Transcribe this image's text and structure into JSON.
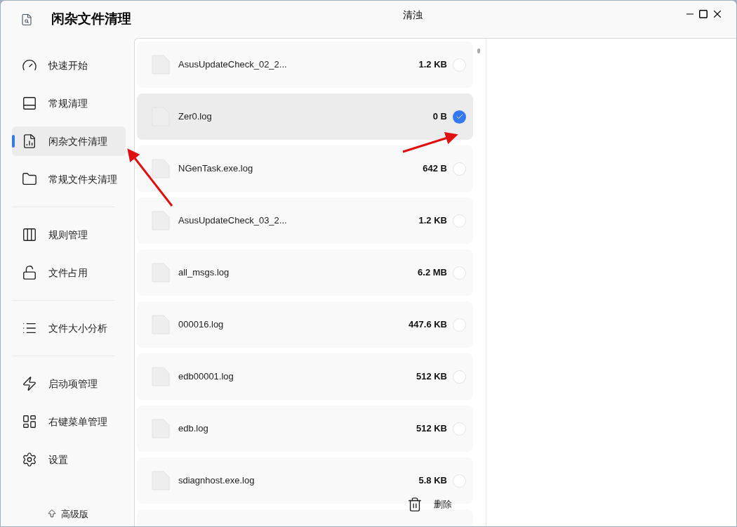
{
  "app_title": "闲杂文件清理",
  "window": {
    "title": "清浊"
  },
  "sidebar": {
    "groups": [
      {
        "items": [
          {
            "label": "快速开始",
            "selected": false
          },
          {
            "label": "常规清理",
            "selected": false
          },
          {
            "label": "闲杂文件清理",
            "selected": true
          },
          {
            "label": "常规文件夹清理",
            "selected": false
          }
        ]
      },
      {
        "items": [
          {
            "label": "规则管理",
            "selected": false
          },
          {
            "label": "文件占用",
            "selected": false
          }
        ]
      },
      {
        "items": [
          {
            "label": "文件大小分析",
            "selected": false
          }
        ]
      },
      {
        "items": [
          {
            "label": "启动项管理",
            "selected": false
          },
          {
            "label": "右键菜单管理",
            "selected": false
          },
          {
            "label": "设置",
            "selected": false
          }
        ]
      }
    ],
    "footer": "高级版"
  },
  "files": [
    {
      "name": "AsusUpdateCheck_02_2...",
      "size": "1.2 KB",
      "checked": false
    },
    {
      "name": "Zer0.log",
      "size": "0 B",
      "checked": true
    },
    {
      "name": "NGenTask.exe.log",
      "size": "642 B",
      "checked": false
    },
    {
      "name": "AsusUpdateCheck_03_2...",
      "size": "1.2 KB",
      "checked": false
    },
    {
      "name": "all_msgs.log",
      "size": "6.2 MB",
      "checked": false
    },
    {
      "name": "000016.log",
      "size": "447.6 KB",
      "checked": false
    },
    {
      "name": "edb00001.log",
      "size": "512 KB",
      "checked": false
    },
    {
      "name": "edb.log",
      "size": "512 KB",
      "checked": false
    },
    {
      "name": "sdiagnhost.exe.log",
      "size": "5.8 KB",
      "checked": false
    }
  ],
  "delete_button": "删除"
}
